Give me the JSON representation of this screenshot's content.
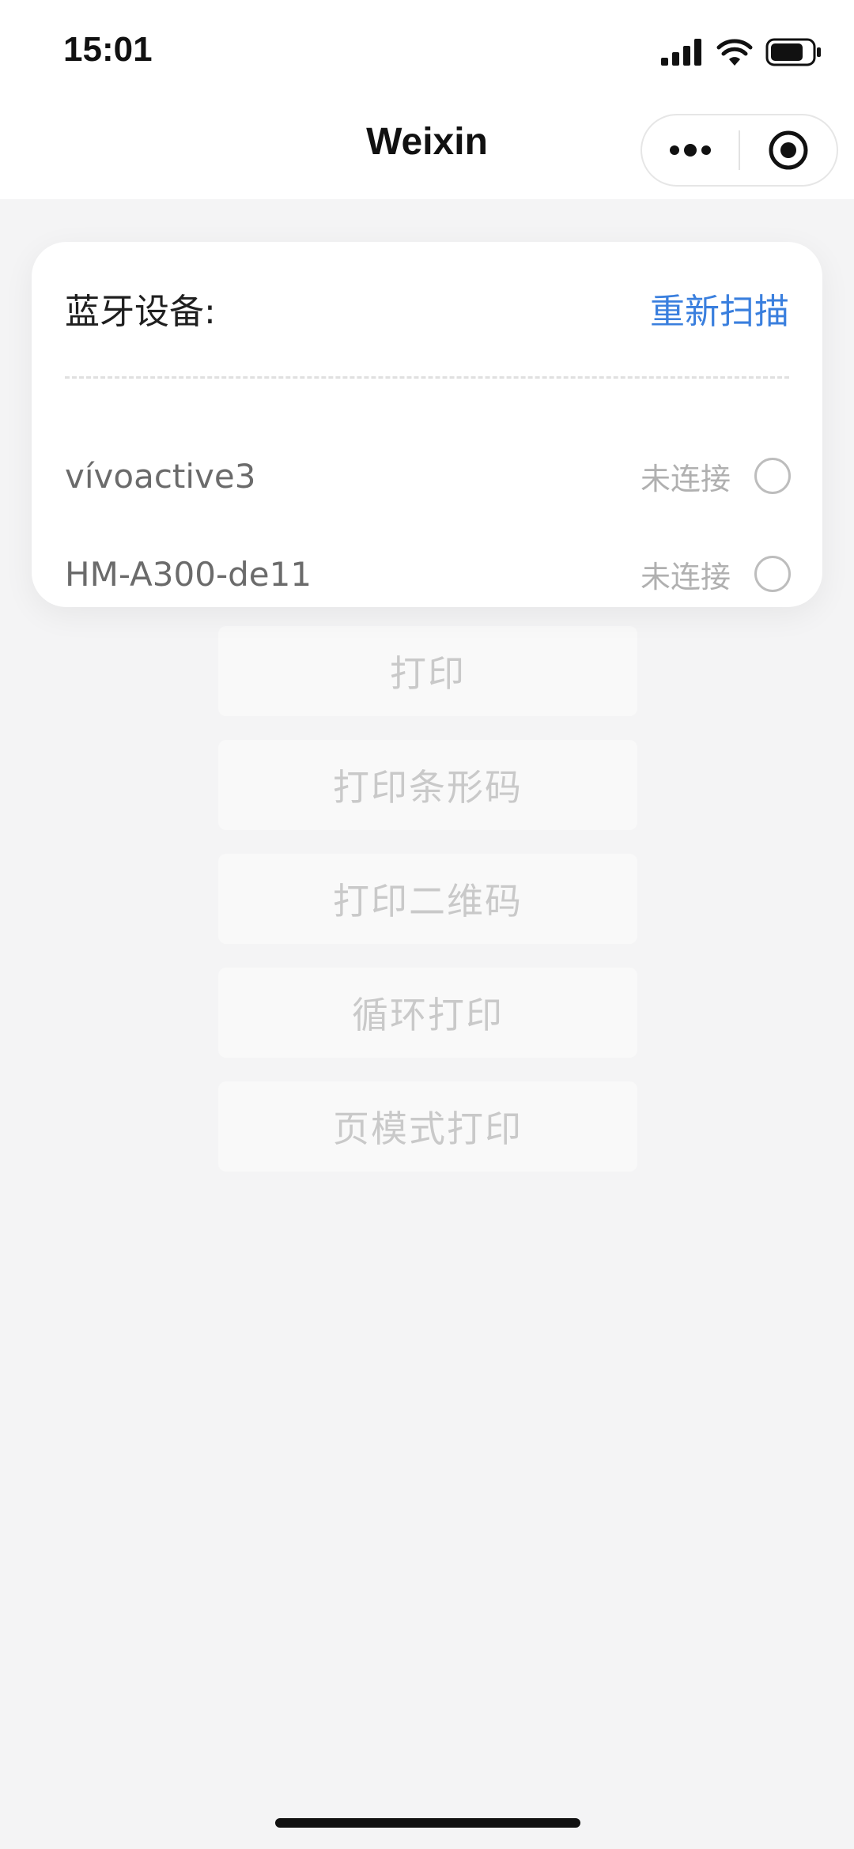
{
  "status_bar": {
    "time": "15:01"
  },
  "nav": {
    "title": "Weixin"
  },
  "bluetooth_card": {
    "title": "蓝牙设备:",
    "rescan_label": "重新扫描",
    "devices": [
      {
        "name": "vívoactive3",
        "status": "未连接"
      },
      {
        "name": "HM-A300-de11",
        "status": "未连接"
      }
    ]
  },
  "actions": {
    "print": "打印",
    "print_barcode": "打印条形码",
    "print_qrcode": "打印二维码",
    "loop_print": "循环打印",
    "page_mode_print": "页模式打印"
  },
  "colors": {
    "accent": "#3a7fde",
    "background": "#f4f4f5"
  }
}
